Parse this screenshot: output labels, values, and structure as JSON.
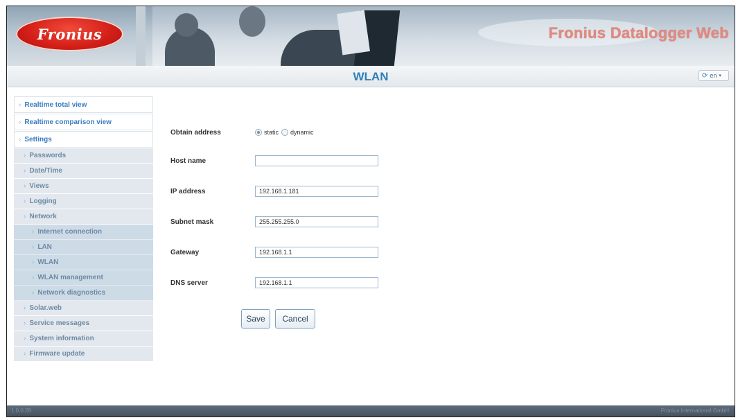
{
  "header": {
    "logo_text": "Fronius",
    "app_title": "Fronius Datalogger Web"
  },
  "titlebar": {
    "page_title": "WLAN",
    "language": "en",
    "language_chevron": "▾",
    "globe_icon": "⟳"
  },
  "sidebar": {
    "bullet": "›",
    "items": [
      {
        "label": "Realtime total view",
        "level": 0
      },
      {
        "label": "Realtime comparison view",
        "level": 0
      },
      {
        "label": "Settings",
        "level": 0
      },
      {
        "label": "Passwords",
        "level": 1
      },
      {
        "label": "Date/Time",
        "level": 1
      },
      {
        "label": "Views",
        "level": 1
      },
      {
        "label": "Logging",
        "level": 1
      },
      {
        "label": "Network",
        "level": 1
      },
      {
        "label": "Internet connection",
        "level": 2
      },
      {
        "label": "LAN",
        "level": 2
      },
      {
        "label": "WLAN",
        "level": 2
      },
      {
        "label": "WLAN management",
        "level": 2
      },
      {
        "label": "Network diagnostics",
        "level": 2
      },
      {
        "label": "Solar.web",
        "level": 1
      },
      {
        "label": "Service messages",
        "level": 1
      },
      {
        "label": "System information",
        "level": 1
      },
      {
        "label": "Firmware update",
        "level": 1
      }
    ]
  },
  "form": {
    "obtain_address_label": "Obtain address",
    "obtain_static_label": "static",
    "obtain_dynamic_label": "dynamic",
    "obtain_selected": "static",
    "host_name_label": "Host name",
    "host_name_value": "",
    "ip_address_label": "IP address",
    "ip_address_value": "192.168.1.181",
    "subnet_mask_label": "Subnet mask",
    "subnet_mask_value": "255.255.255.0",
    "gateway_label": "Gateway",
    "gateway_value": "192.168.1.1",
    "dns_server_label": "DNS server",
    "dns_server_value": "192.168.1.1",
    "save_label": "Save",
    "cancel_label": "Cancel"
  },
  "footer": {
    "left_text": "1.0.0.28",
    "right_text": "Fronius International GmbH"
  },
  "colors": {
    "accent_blue": "#2e7fb8",
    "logo_red": "#d41f18",
    "footer_bg": "#46525f"
  }
}
